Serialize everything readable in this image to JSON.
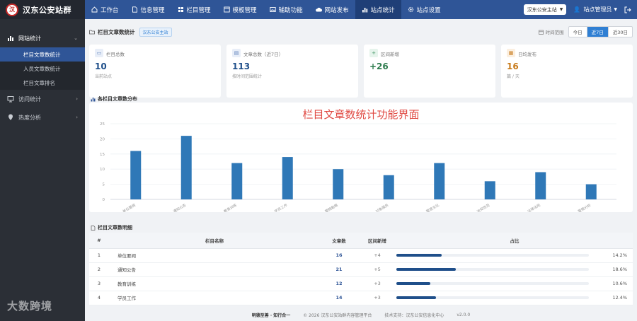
{
  "brand": {
    "badge": "汉",
    "name": "汉东公安站群"
  },
  "nav": [
    {
      "label": "工作台",
      "icon": "home-icon",
      "active": false
    },
    {
      "label": "信息管理",
      "icon": "document-icon",
      "active": false
    },
    {
      "label": "栏目管理",
      "icon": "grid-icon",
      "active": false
    },
    {
      "label": "模板管理",
      "icon": "template-icon",
      "active": false
    },
    {
      "label": "辅助功能",
      "icon": "image-icon",
      "active": false
    },
    {
      "label": "网站发布",
      "icon": "cloud-upload-icon",
      "active": false
    },
    {
      "label": "站点统计",
      "icon": "bar-chart-icon",
      "active": true
    },
    {
      "label": "站点设置",
      "icon": "gear-icon",
      "active": false
    }
  ],
  "header_right": {
    "site": "汉东公安主站",
    "user": "站点管理员"
  },
  "sidebar": {
    "group1": "网站统计",
    "subs": [
      "栏目文章数统计",
      "人员文章数统计",
      "栏目文章排名"
    ],
    "group2": "访问统计",
    "group3": "热度分析"
  },
  "panel": {
    "title": "栏目文章数统计",
    "tag": "汉东公安主站",
    "range_label": "时间范围",
    "ranges": [
      "今日",
      "近7日",
      "近30日"
    ],
    "active_range": 1
  },
  "cards": [
    {
      "label": "栏目总数",
      "value": "10",
      "note": "当前站点",
      "icon": "folder-icon",
      "color": "#5b7fb8",
      "bg": "#e8eef8"
    },
    {
      "label": "文章总数（近7日）",
      "value": "113",
      "note": "按时间范围统计",
      "icon": "document-icon",
      "color": "#5b7fb8",
      "bg": "#e8eef8"
    },
    {
      "label": "区间新增",
      "value": "+26",
      "note": "",
      "icon": "plus-icon",
      "color": "#3b9160",
      "bg": "#e6f4ec"
    },
    {
      "label": "日均发布",
      "value": "16",
      "note": "篇 / 天",
      "icon": "calendar-icon",
      "color": "#c77a1a",
      "bg": "#fbefe0"
    }
  ],
  "chart_title": "各栏目文章数分布",
  "overlay_title": "栏目文章数统计功能界面",
  "chart_data": {
    "type": "bar",
    "categories": [
      "单位要闻",
      "通知公告",
      "教育训练",
      "学员工作",
      "警務動態",
      "对象服务",
      "警营文化",
      "治安防范",
      "法律法规",
      "警情分析"
    ],
    "values": [
      16,
      21,
      12,
      14,
      10,
      8,
      12,
      6,
      9,
      5
    ],
    "ylim": [
      0,
      25
    ],
    "yticks": [
      0,
      5,
      10,
      15,
      20,
      25
    ],
    "grid": true,
    "bar_color": "#2f78b7"
  },
  "table_title": "栏目文章数明细",
  "table": {
    "headers": [
      "#",
      "栏目名称",
      "文章数",
      "区间新增",
      "占比"
    ],
    "rows": [
      {
        "idx": "1",
        "name": "单位要闻",
        "count": "16",
        "inc": "+4",
        "pct": "14.2%",
        "fill": 0.142
      },
      {
        "idx": "2",
        "name": "通知公告",
        "count": "21",
        "inc": "+5",
        "pct": "18.6%",
        "fill": 0.186
      },
      {
        "idx": "3",
        "name": "教育训练",
        "count": "12",
        "inc": "+3",
        "pct": "10.6%",
        "fill": 0.106
      },
      {
        "idx": "4",
        "name": "学员工作",
        "count": "14",
        "inc": "+3",
        "pct": "12.4%",
        "fill": 0.124
      }
    ]
  },
  "footer": {
    "motto": "明德至善 · 知行合一",
    "copyright": "© 2026 汉东公安站群内容管理平台",
    "support": "技术支持：汉东公安信息化中心",
    "version": "v2.0.0"
  },
  "watermark": "大数跨境"
}
